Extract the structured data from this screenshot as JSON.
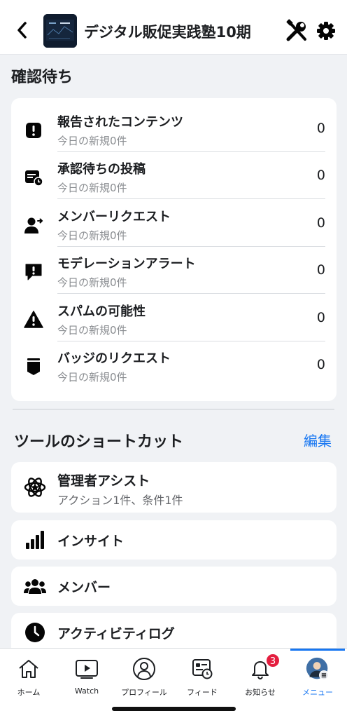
{
  "header": {
    "back_icon": "chevron-left-icon",
    "title": "デジタル販促実践塾10期",
    "tools_icon": "admin-tools-icon",
    "settings_icon": "gear-icon"
  },
  "pending": {
    "title": "確認待ち",
    "items": [
      {
        "icon": "exclamation-square-icon",
        "label": "報告されたコンテンツ",
        "sub": "今日の新規0件",
        "count": "0"
      },
      {
        "icon": "post-clock-icon",
        "label": "承認待ちの投稿",
        "sub": "今日の新規0件",
        "count": "0"
      },
      {
        "icon": "member-request-icon",
        "label": "メンバーリクエスト",
        "sub": "今日の新規0件",
        "count": "0"
      },
      {
        "icon": "alert-bubble-icon",
        "label": "モデレーションアラート",
        "sub": "今日の新規0件",
        "count": "0"
      },
      {
        "icon": "warning-triangle-icon",
        "label": "スパムの可能性",
        "sub": "今日の新規0件",
        "count": "0"
      },
      {
        "icon": "badge-icon",
        "label": "バッジのリクエスト",
        "sub": "今日の新規0件",
        "count": "0"
      }
    ]
  },
  "tools": {
    "title": "ツールのショートカット",
    "edit_label": "編集",
    "items": [
      {
        "icon": "admin-assist-icon",
        "label": "管理者アシスト",
        "sub": "アクション1件、条件1件"
      },
      {
        "icon": "insights-bar-icon",
        "label": "インサイト"
      },
      {
        "icon": "members-icon",
        "label": "メンバー"
      },
      {
        "icon": "activity-clock-icon",
        "label": "アクティビティログ"
      }
    ]
  },
  "nav": {
    "items": [
      {
        "icon": "home-icon",
        "label": "ホーム"
      },
      {
        "icon": "watch-icon",
        "label": "Watch"
      },
      {
        "icon": "profile-icon",
        "label": "プロフィール"
      },
      {
        "icon": "feed-icon",
        "label": "フィード"
      },
      {
        "icon": "bell-icon",
        "label": "お知らせ",
        "badge": "3"
      },
      {
        "icon": "avatar-menu-icon",
        "label": "メニュー",
        "active": true
      }
    ]
  },
  "colors": {
    "accent": "#1877f2",
    "badge": "#e41e3f",
    "background": "#f0f2f5"
  }
}
